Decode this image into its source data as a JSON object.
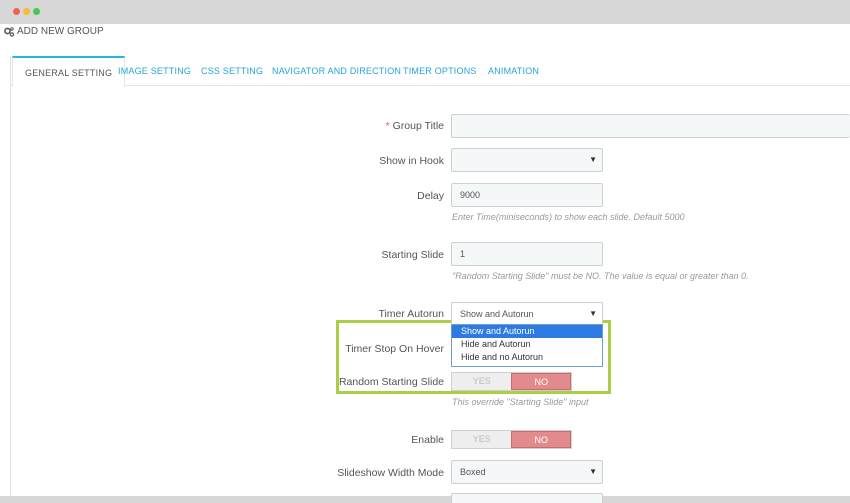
{
  "header": {
    "title": "ADD NEW GROUP",
    "icon": "cogs-icon"
  },
  "tabs": [
    {
      "label": "GENERAL SETTING",
      "active": true
    },
    {
      "label": "IMAGE SETTING",
      "active": false
    },
    {
      "label": "CSS SETTING",
      "active": false
    },
    {
      "label": "NAVIGATOR AND DIRECTION",
      "active": false
    },
    {
      "label": "TIMER OPTIONS",
      "active": false
    },
    {
      "label": "ANIMATION",
      "active": false
    }
  ],
  "form": {
    "group_title": {
      "label": "Group Title",
      "required_mark": "*",
      "value": ""
    },
    "show_in_hook": {
      "label": "Show in Hook",
      "value": ""
    },
    "delay": {
      "label": "Delay",
      "value": "9000",
      "help": "Enter Time(miniseconds) to show each slide. Default 5000"
    },
    "starting_slide": {
      "label": "Starting Slide",
      "value": "1",
      "help": "\"Random Starting Slide\" must be NO. The value is equal or greater than 0."
    },
    "timer_autorun": {
      "label": "Timer Autorun",
      "value": "Show and Autorun",
      "options": [
        "Show and Autorun",
        "Hide and Autorun",
        "Hide and no Autorun"
      ]
    },
    "timer_stop_on_hover": {
      "label": "Timer Stop On Hover"
    },
    "random_starting_slide": {
      "label": "Random Starting Slide",
      "yes": "YES",
      "no": "NO",
      "help": "This override \"Starting Slide\" input"
    },
    "enable": {
      "label": "Enable",
      "yes": "YES",
      "no": "NO"
    },
    "slideshow_width_mode": {
      "label": "Slideshow Width Mode",
      "value": "Boxed"
    }
  },
  "colors": {
    "tab_link": "#25a5d9",
    "highlight_border": "#a9cf45",
    "switch_no": "#e28a8c",
    "selected_option": "#2d7be0"
  }
}
